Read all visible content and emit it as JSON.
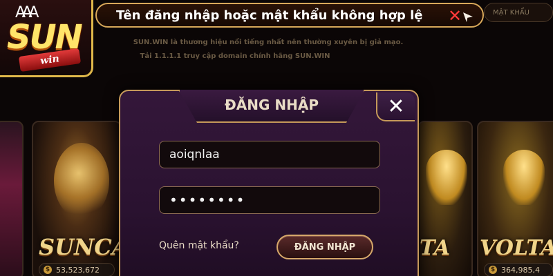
{
  "logo": {
    "cards": "AAA",
    "brand": "SUN",
    "ribbon": "win"
  },
  "toast": {
    "message": "Tên đăng nhập hoặc mật khẩu không hợp lệ"
  },
  "top_right": {
    "label": "MẬT KHẨU"
  },
  "notice": {
    "line1": "SUN.WIN là thương hiệu nổi tiếng nhất nên thường xuyên bị giả mạo.",
    "line2": "Tải 1.1.1.1 truy cập domain chính hãng SUN.WIN"
  },
  "dialog": {
    "title": "ĐĂNG NHẬP",
    "close": "✕",
    "username_value": "aoiqnlaa",
    "password_value": "••••••••",
    "forgot_label": "Quên mật khẩu?",
    "login_button": "ĐĂNG NHẬP"
  },
  "games": {
    "sun_casino": {
      "title": "SUNCA",
      "counter": "53,523,672"
    },
    "volta": {
      "title": "VOLTA",
      "counter": "364,985,4"
    },
    "middle_partial": {
      "title": "TA"
    }
  },
  "colors": {
    "accent_gold": "#c69a5a",
    "toast_text": "#ffffff",
    "error_red": "#ff3a3a"
  }
}
